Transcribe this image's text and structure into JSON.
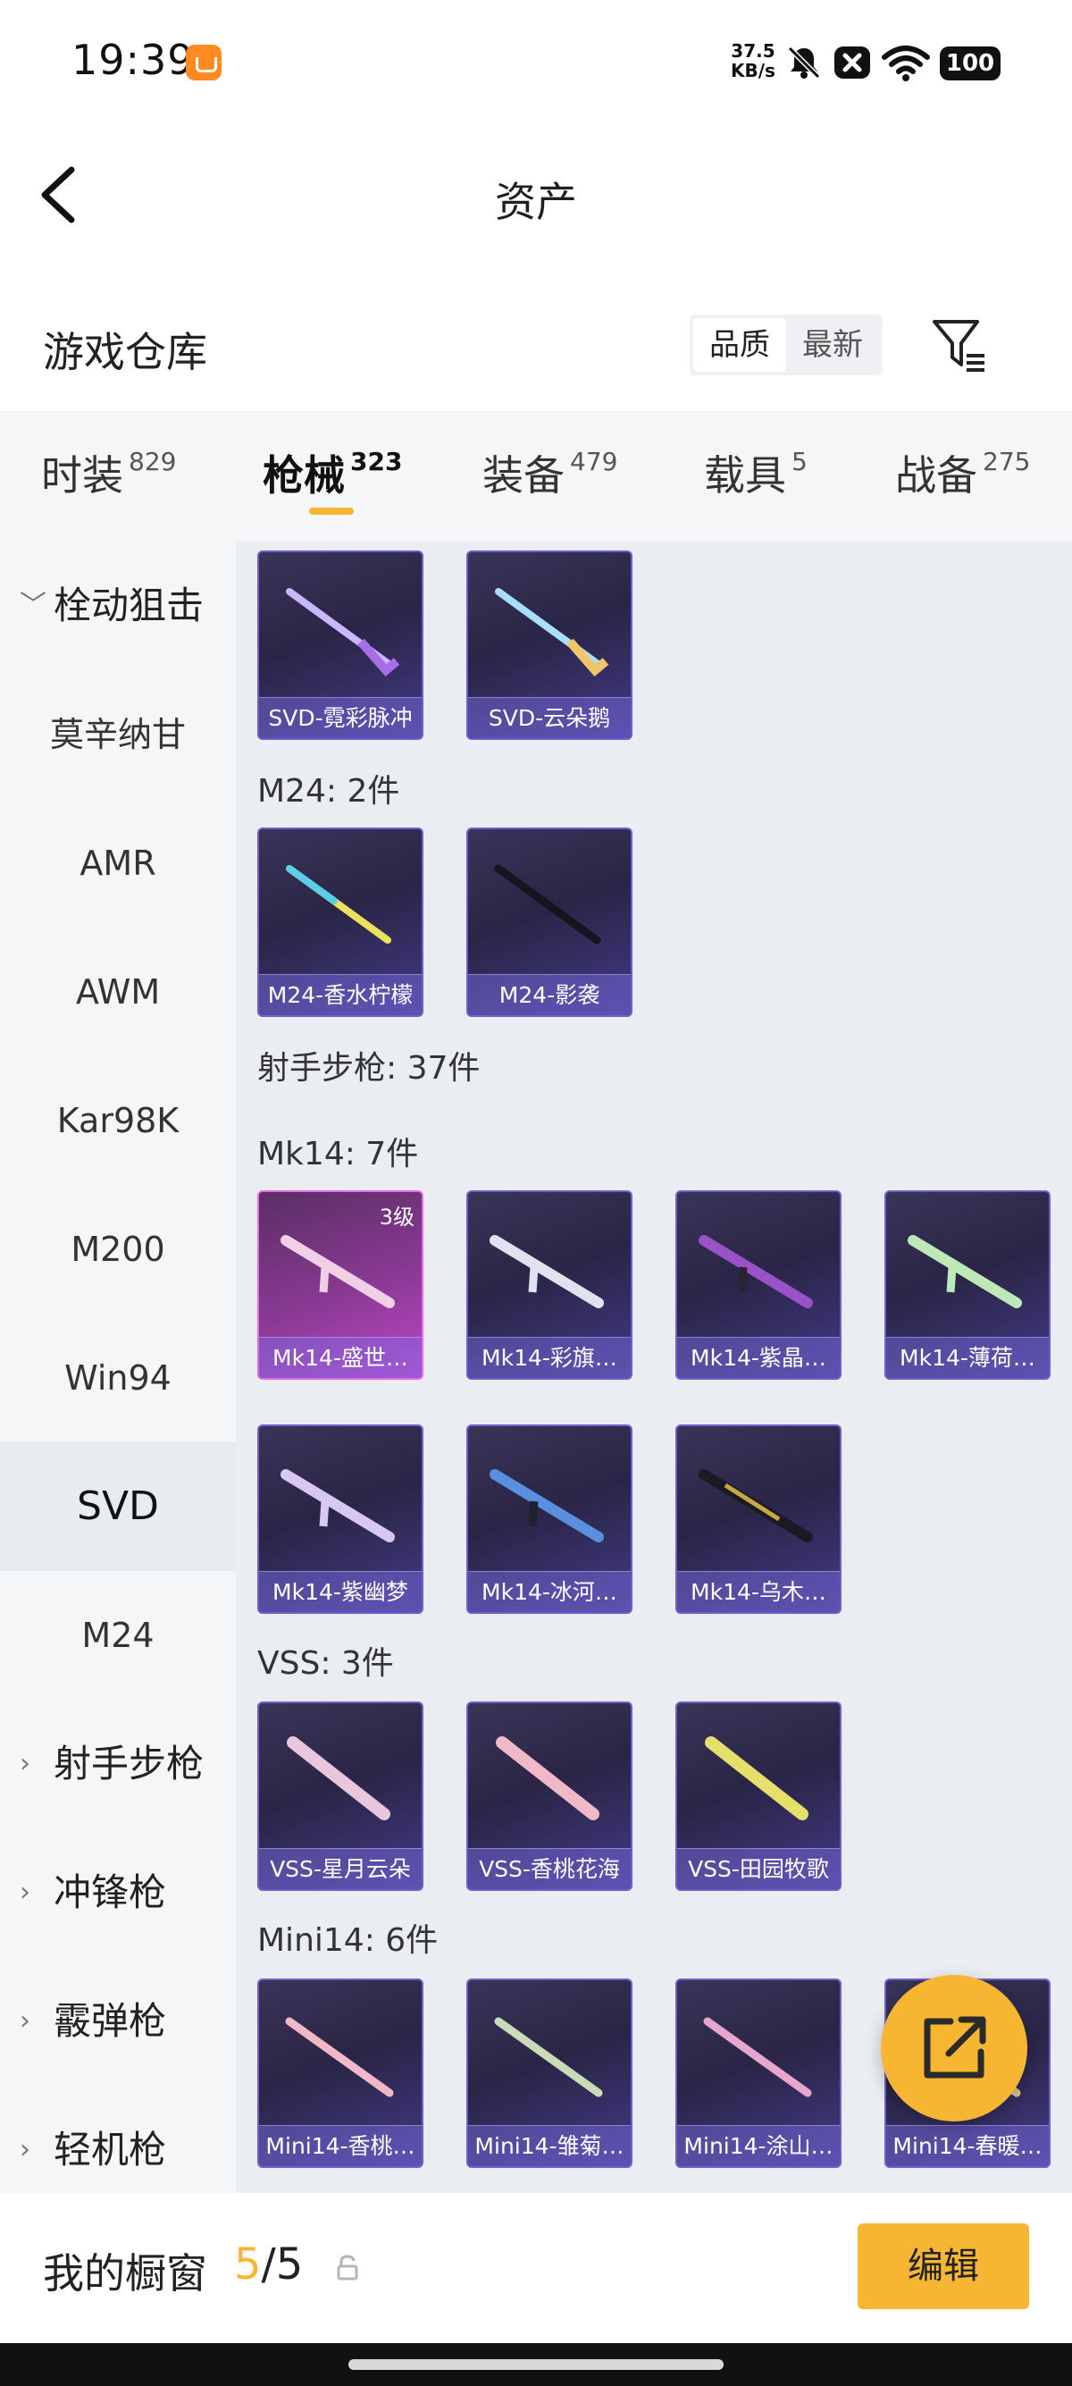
{
  "status_bar": {
    "time": "19:39",
    "net_speed_value": "37.5",
    "net_speed_unit": "KB/s",
    "battery": "100",
    "icons": [
      "app-notification-icon",
      "mute-icon",
      "close-box-icon",
      "wifi-icon",
      "battery-icon"
    ]
  },
  "header": {
    "title": "资产",
    "back_icon": "chevron-left-icon"
  },
  "warehouse": {
    "title": "游戏仓库",
    "sort_options": [
      "品质",
      "最新"
    ],
    "selected_sort": "品质",
    "filter_icon": "filter-list-icon"
  },
  "tabs": [
    {
      "label": "时装",
      "count": "829"
    },
    {
      "label": "枪械",
      "count": "323"
    },
    {
      "label": "装备",
      "count": "479"
    },
    {
      "label": "载具",
      "count": "5"
    },
    {
      "label": "战备",
      "count": "275"
    }
  ],
  "active_tab": "枪械",
  "sidebar": {
    "items": [
      {
        "label": "栓动狙击",
        "type": "group",
        "expanded": true
      },
      {
        "label": "莫辛纳甘",
        "type": "sub"
      },
      {
        "label": "AMR",
        "type": "sub"
      },
      {
        "label": "AWM",
        "type": "sub"
      },
      {
        "label": "Kar98K",
        "type": "sub"
      },
      {
        "label": "M200",
        "type": "sub"
      },
      {
        "label": "Win94",
        "type": "sub"
      },
      {
        "label": "SVD",
        "type": "sub",
        "selected": true
      },
      {
        "label": "M24",
        "type": "sub"
      },
      {
        "label": "射手步枪",
        "type": "group",
        "expanded": false
      },
      {
        "label": "冲锋枪",
        "type": "group",
        "expanded": false
      },
      {
        "label": "霰弹枪",
        "type": "group",
        "expanded": false
      },
      {
        "label": "轻机枪",
        "type": "group",
        "expanded": false
      }
    ]
  },
  "content": {
    "svd_items": [
      "SVD-霓彩脉冲",
      "SVD-云朵鹅"
    ],
    "m24_label": "M24: 2件",
    "m24_items": [
      "M24-香水柠檬",
      "M24-影袭"
    ],
    "marksman_label": "射手步枪: 37件",
    "mk14_label": "Mk14: 7件",
    "mk14_items": [
      "Mk14-盛世…",
      "Mk14-彩旗…",
      "Mk14-紫晶…",
      "Mk14-薄荷…",
      "Mk14-紫幽梦",
      "Mk14-冰河…",
      "Mk14-乌木…"
    ],
    "mk14_badge": "3级",
    "vss_label": "VSS: 3件",
    "vss_items": [
      "VSS-星月云朵",
      "VSS-香桃花海",
      "VSS-田园牧歌"
    ],
    "mini14_label": "Mini14: 6件",
    "mini14_items": [
      "Mini14-香桃…",
      "Mini14-雏菊…",
      "Mini14-涂山…",
      "Mini14-春暖…"
    ]
  },
  "fab": {
    "icon": "share-external-icon"
  },
  "bottom": {
    "showcase_label": "我的橱窗",
    "showcase_current": "5",
    "showcase_total": "/5",
    "edit_label": "编辑"
  },
  "colors": {
    "accent": "#f6b632",
    "card_border": "#6e5fd0",
    "card_highlight_border": "#e76be9",
    "sidebar_bg": "#f4f6f8",
    "content_bg": "#eaedf2"
  }
}
